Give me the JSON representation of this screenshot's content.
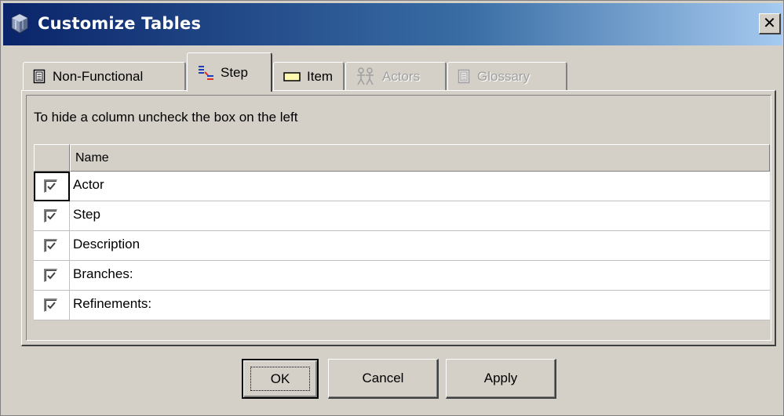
{
  "window": {
    "title": "Customize Tables"
  },
  "icons": {
    "app": "app-cube-icon",
    "close": "close-icon"
  },
  "tabs": [
    {
      "label": "Non-Functional",
      "icon": "document-icon",
      "state": "normal"
    },
    {
      "label": "Step",
      "icon": "step-icon",
      "state": "active"
    },
    {
      "label": "Item",
      "icon": "item-icon",
      "state": "normal"
    },
    {
      "label": "Actors",
      "icon": "actors-icon",
      "state": "disabled"
    },
    {
      "label": "Glossary",
      "icon": "glossary-icon",
      "state": "disabled"
    }
  ],
  "panel": {
    "hint": "To hide a column uncheck the box on the left",
    "table": {
      "header": "Name",
      "rows": [
        {
          "label": "Actor",
          "checked": true
        },
        {
          "label": "Step",
          "checked": true
        },
        {
          "label": "Description",
          "checked": true
        },
        {
          "label": "Branches:",
          "checked": true
        },
        {
          "label": "Refinements:",
          "checked": true
        }
      ]
    }
  },
  "buttons": {
    "ok": "OK",
    "cancel": "Cancel",
    "apply": "Apply"
  },
  "colors": {
    "titlebar_start": "#0a246a",
    "titlebar_end": "#a6caf0",
    "face": "#d4d0c8"
  }
}
